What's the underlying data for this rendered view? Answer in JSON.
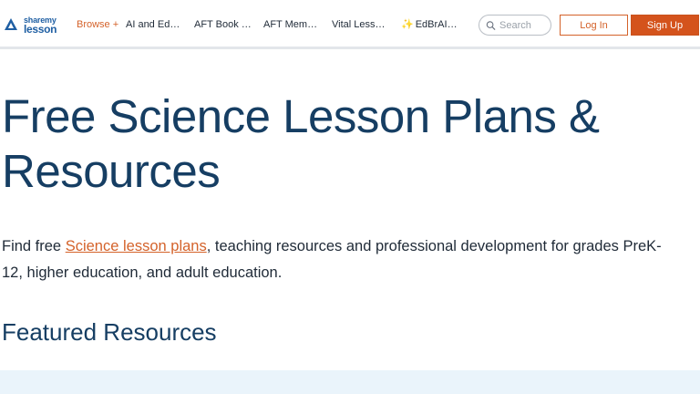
{
  "brand": {
    "line1": "sharemy",
    "line2": "lesson"
  },
  "nav": {
    "browse": "Browse",
    "browse_icon": "plus-icon",
    "items": [
      {
        "label": "AI and Educ…"
      },
      {
        "label": "AFT Book Cl…"
      },
      {
        "label": "AFT Membe…"
      },
      {
        "label": "Vital Lesso…"
      },
      {
        "label": "EdBrAIn I…",
        "icon": "sparkle-icon"
      }
    ]
  },
  "search": {
    "placeholder": "Search"
  },
  "auth": {
    "login": "Log In",
    "signup": "Sign Up"
  },
  "main": {
    "title_line1": "Free Science Lesson Plans &",
    "title_line2": "Resources",
    "intro_before": "Find free ",
    "intro_link": "Science lesson plans",
    "intro_after": ", teaching resources and professional development for grades PreK-12, higher education, and adult education.",
    "featured_heading": "Featured Resources"
  },
  "colors": {
    "accent": "#d4622a",
    "heading": "#163e63",
    "brand_blue": "#1f5fa3",
    "band": "#eaf4fb"
  }
}
